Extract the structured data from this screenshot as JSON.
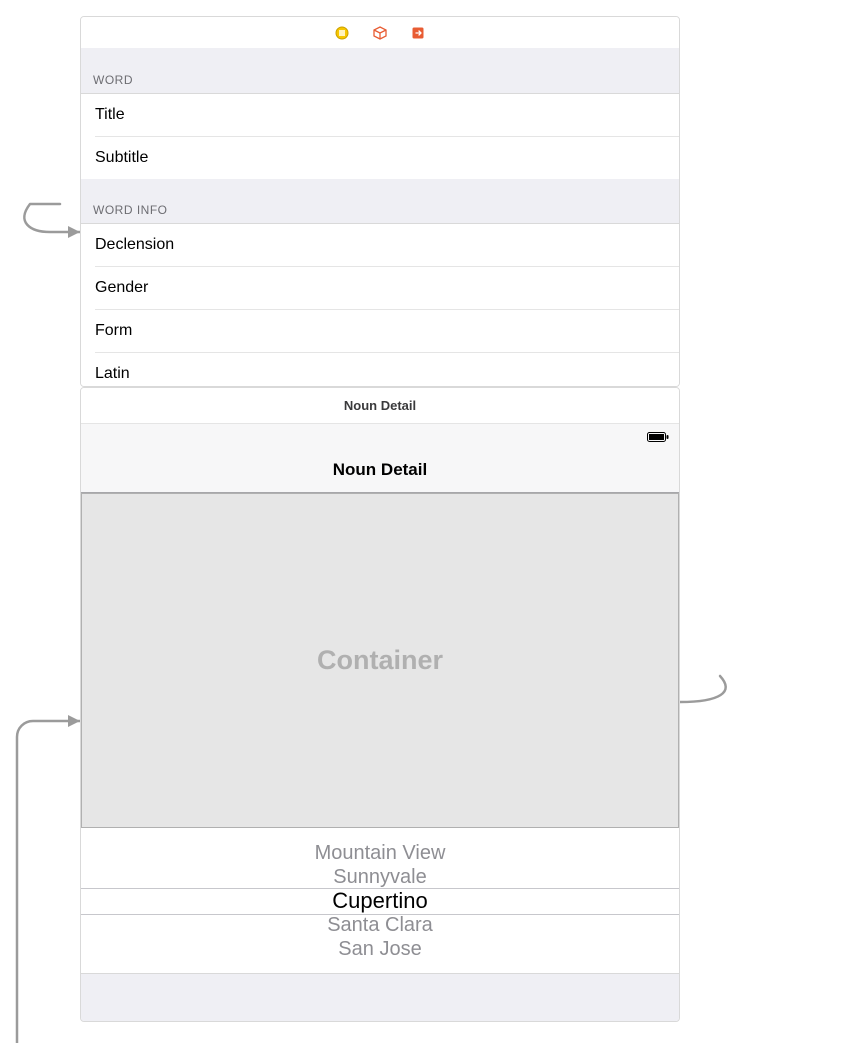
{
  "top_scene": {
    "sections": [
      {
        "header": "WORD",
        "rows": [
          "Title",
          "Subtitle"
        ]
      },
      {
        "header": "WORD INFO",
        "rows": [
          "Declension",
          "Gender",
          "Form",
          "Latin"
        ]
      }
    ]
  },
  "bottom_scene": {
    "scene_label": "Noun Detail",
    "nav_title": "Noun Detail",
    "container_label": "Container",
    "picker_rows": [
      "Mountain View",
      "Sunnyvale",
      "Cupertino",
      "Santa Clara",
      "San Jose"
    ],
    "picker_selected_index": 2
  }
}
